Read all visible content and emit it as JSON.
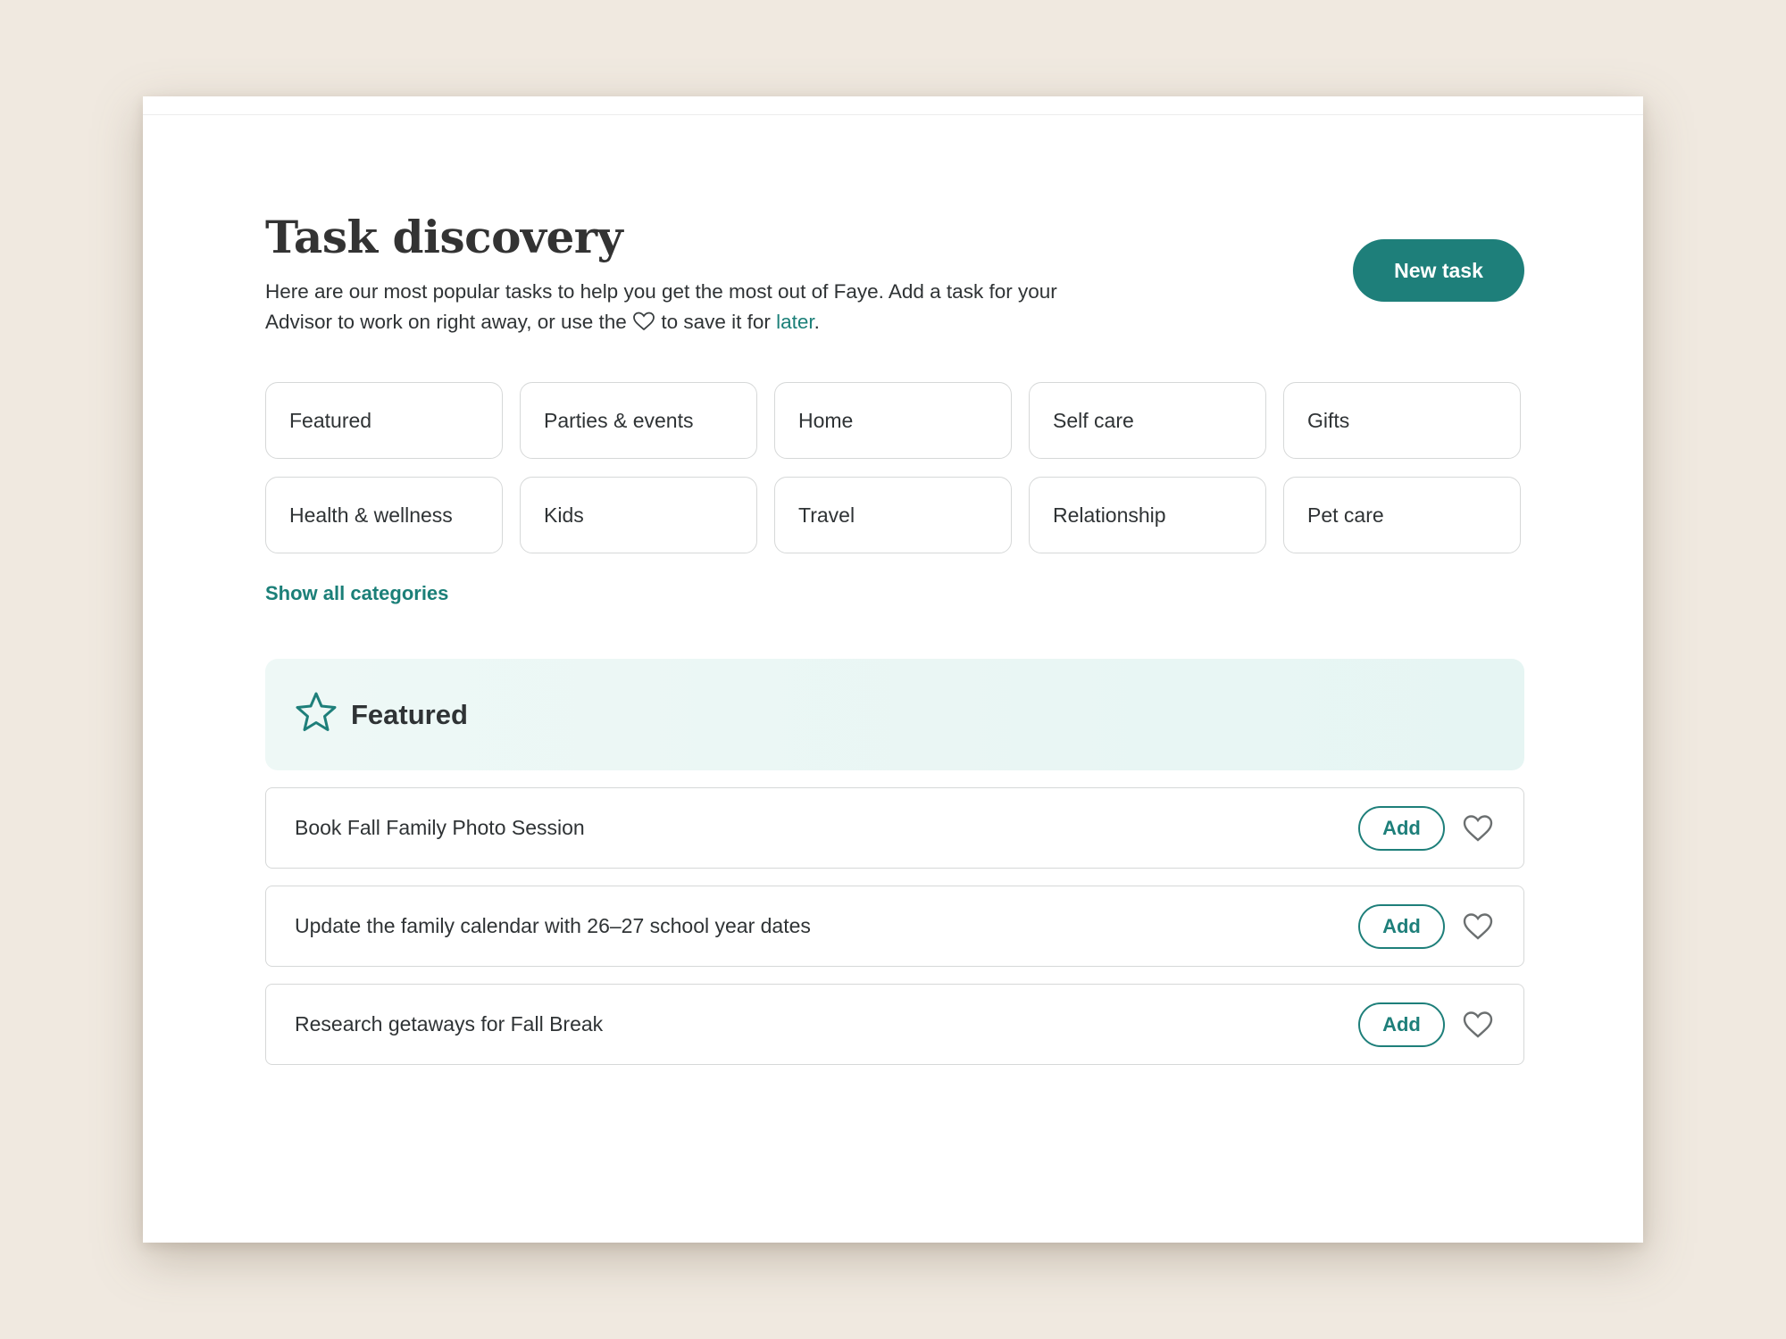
{
  "header": {
    "title": "Task discovery",
    "intro_part1": "Here are our most popular tasks to help you get the most out of Faye. Add a task for your Advisor to work on right away, or use the",
    "intro_part2": "to save it for",
    "intro_link": "later",
    "intro_end": "."
  },
  "new_task_button": "New task",
  "categories": [
    "Featured",
    "Parties & events",
    "Home",
    "Self care",
    "Gifts",
    "Health & wellness",
    "Kids",
    "Travel",
    "Relationship",
    "Pet care"
  ],
  "show_all_link": "Show all categories",
  "featured": {
    "icon": "star-icon",
    "title": "Featured"
  },
  "tasks": [
    {
      "label": "Book Fall Family Photo Session",
      "add_label": "Add"
    },
    {
      "label": "Update the family calendar with 26–27 school year dates",
      "add_label": "Add"
    },
    {
      "label": "Research getaways for Fall Break",
      "add_label": "Add"
    }
  ],
  "colors": {
    "accent": "#1e7f7a",
    "background": "#f0e9e0",
    "banner": "#e8f6f4"
  }
}
